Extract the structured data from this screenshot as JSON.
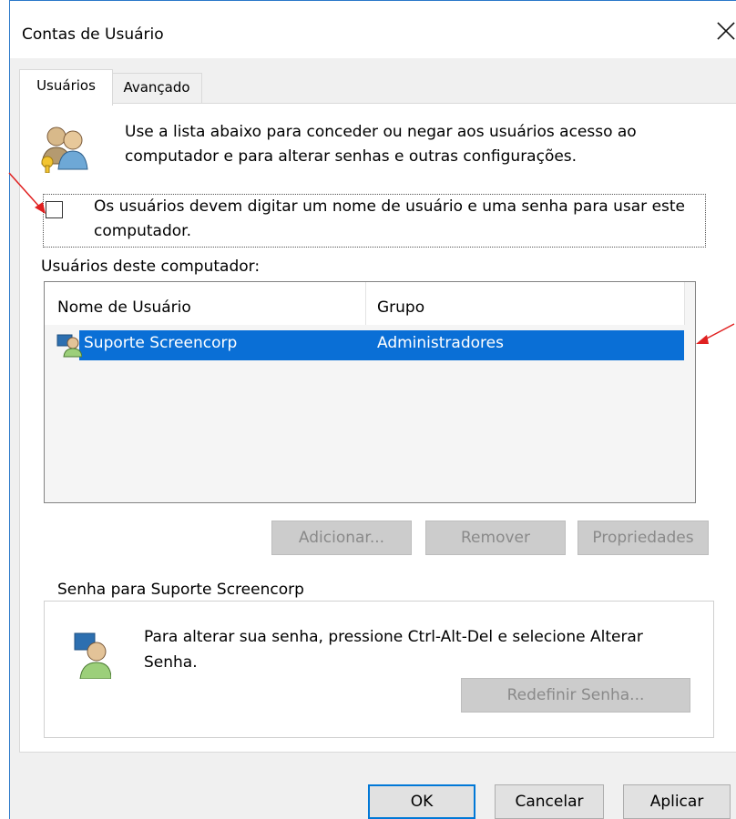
{
  "window": {
    "title": "Contas de Usuário"
  },
  "tabs": [
    {
      "label": "Usuários",
      "active": true
    },
    {
      "label": "Avançado",
      "active": false
    }
  ],
  "intro": {
    "line1": "Use a lista abaixo para conceder ou negar aos usuários acesso ao",
    "line2": "computador e para alterar senhas e outras configurações."
  },
  "checkbox": {
    "line1": "Os usuários devem digitar um nome de usuário e uma senha para usar este",
    "line2": "computador.",
    "checked": false
  },
  "users_section": {
    "label": "Usuários deste computador:",
    "columns": [
      "Nome de Usuário",
      "Grupo"
    ],
    "rows": [
      {
        "name": "Suporte Screencorp",
        "group": "Administradores",
        "selected": true
      }
    ]
  },
  "buttons": {
    "add": "Adicionar...",
    "remove": "Remover",
    "properties": "Propriedades",
    "reset_password": "Redefinir Senha...",
    "ok": "OK",
    "cancel": "Cancelar",
    "apply": "Aplicar"
  },
  "password_group": {
    "title": "Senha para Suporte Screencorp",
    "line1": "Para alterar sua senha, pressione Ctrl-Alt-Del e selecione Alterar",
    "line2": "Senha."
  },
  "colors": {
    "selection": "#0a6fd6",
    "accent": "#0078d7",
    "annotation_arrow": "#e02020"
  }
}
